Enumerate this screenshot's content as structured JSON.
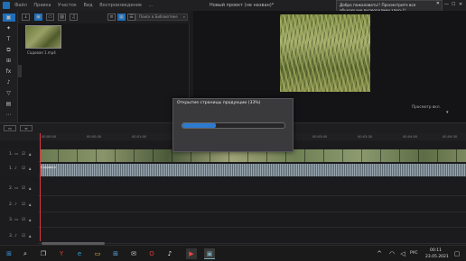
{
  "titlebar": {
    "menu": [
      "Файл",
      "Правка",
      "Участок",
      "Вид",
      "Воспроизведение",
      "..."
    ],
    "project_title": "Новый проект (не назван)*",
    "window_controls": [
      "—",
      "☐",
      "✕"
    ]
  },
  "notification": {
    "text": "Добро пожаловать!! Просмотрите все обучающие видеоролики здесь!!"
  },
  "library": {
    "search_placeholder": "Поиск в Библиотеке",
    "items": [
      {
        "label": "Садовая 1.mp4"
      }
    ]
  },
  "preview": {
    "status": "Просмотр вкл."
  },
  "timeline": {
    "ruler_labels": [
      "00:00:00",
      "00:00:30",
      "00:01:00",
      "00:01:30",
      "00:02:00",
      "00:02:30",
      "00:03:00",
      "00:03:30",
      "00:04:00",
      "00:04:30"
    ],
    "tracks": [
      {
        "label": "1."
      },
      {
        "label": "1."
      },
      {
        "label": "2."
      },
      {
        "label": "2."
      },
      {
        "label": "3."
      },
      {
        "label": "3."
      }
    ],
    "audio_clip_label": "Садовая"
  },
  "dialog": {
    "title": "Открытие страницы продукции (33%)",
    "progress": 0.33
  },
  "taskbar": {
    "time": "00:11",
    "date": "23.05.2021",
    "lang": "РУС"
  }
}
